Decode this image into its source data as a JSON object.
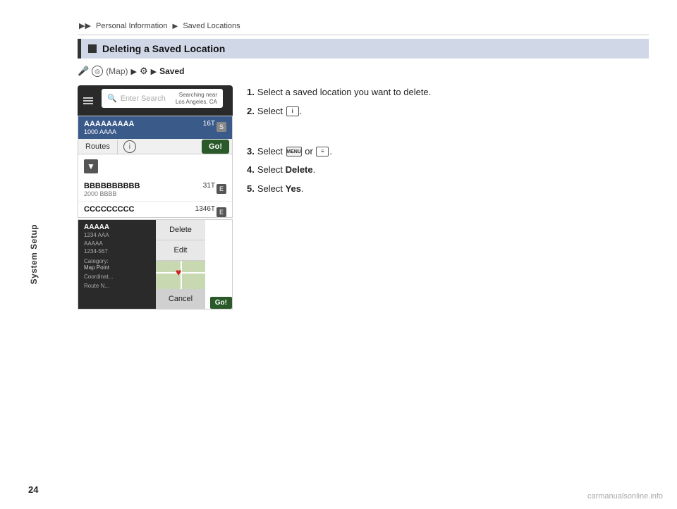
{
  "breadcrumb": {
    "triangles": "▶▶",
    "part1": "Personal Information",
    "arrow1": "▶",
    "part2": "Saved Locations"
  },
  "sidebar": {
    "label": "System Setup"
  },
  "section": {
    "title": "Deleting a Saved Location"
  },
  "nav_path": {
    "map_label": "Map",
    "saved_label": "Saved"
  },
  "search": {
    "placeholder": "Enter Search",
    "searching_near": "Searching near",
    "location": "Los Angeles, CA"
  },
  "locations": [
    {
      "name": "AAAAAAAAA",
      "addr": "1000 AAAA",
      "dist": "16T",
      "letter": "S"
    },
    {
      "name": "BBBBBBBBBB",
      "addr": "2000 BBBB",
      "dist": "31T",
      "letter": "E"
    },
    {
      "name": "CCCCCCCCC",
      "addr": "",
      "dist": "1346T",
      "letter": "E"
    }
  ],
  "routes_btn": "Routes",
  "go_btn": "Go!",
  "overlay": {
    "name": "AAAAA",
    "addr1": "1234 AAA",
    "addr2": "AAAAA",
    "addr3": "1234-567",
    "cat_label": "Category:",
    "cat_value": "Map Point",
    "coord_label": "Coordinat...",
    "route_label": "Route N..."
  },
  "overlay_menu": [
    {
      "label": "Delete"
    },
    {
      "label": "Edit"
    },
    {
      "label": "Cancel"
    }
  ],
  "instructions": {
    "step1": "Select a saved location you want to delete.",
    "step2_pre": "Select ",
    "step2_icon": "i",
    "step3_pre": "Select ",
    "step3_menu_icon": "MENU",
    "step3_mid": " or ",
    "step3_list_icon": "≡",
    "step4_pre": "Select ",
    "step4_bold": "Delete",
    "step5_pre": "Select ",
    "step5_bold": "Yes"
  },
  "page_number": "24",
  "watermark": "carmanualsonline.info"
}
